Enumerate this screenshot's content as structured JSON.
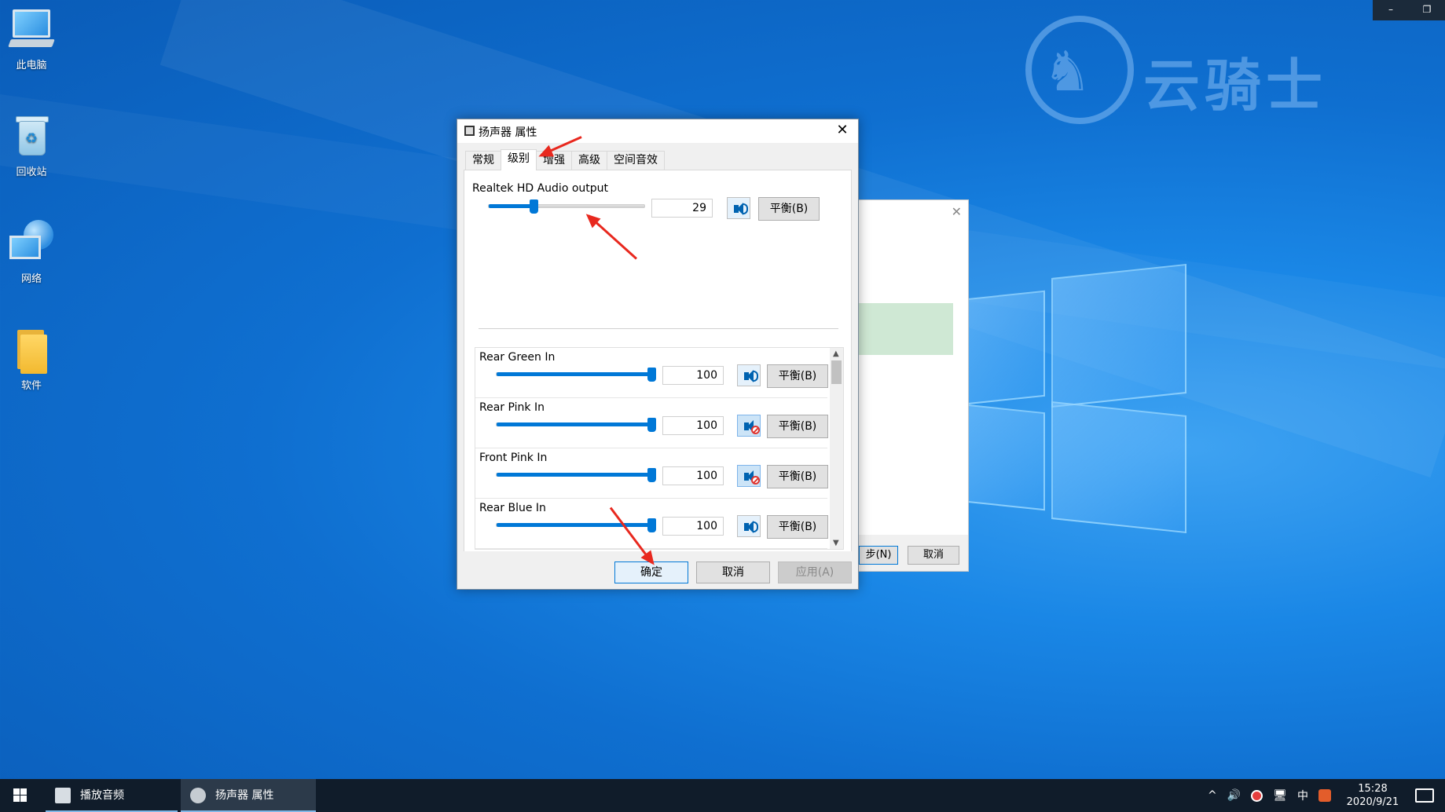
{
  "desktop": {
    "icons": [
      {
        "label": "此电脑"
      },
      {
        "label": "回收站"
      },
      {
        "label": "网络"
      },
      {
        "label": "软件"
      }
    ],
    "watermark": {
      "text": "云骑士"
    }
  },
  "top_controls": {
    "minimize": "–",
    "restore": "❐"
  },
  "background_dialog": {
    "close": "✕",
    "next_label": "步(N)",
    "cancel_label": "取消"
  },
  "dialog": {
    "title": "扬声器 属性",
    "close": "✕",
    "tabs": [
      {
        "label": "常规"
      },
      {
        "label": "级别"
      },
      {
        "label": "增强"
      },
      {
        "label": "高级"
      },
      {
        "label": "空间音效"
      }
    ],
    "active_tab": "级别",
    "main_device": {
      "label": "Realtek HD Audio output",
      "volume": "29",
      "muted": false,
      "balance_label": "平衡(B)"
    },
    "inputs": [
      {
        "label": "Rear Green In",
        "volume": "100",
        "muted": false,
        "balance_label": "平衡(B)"
      },
      {
        "label": "Rear Pink In",
        "volume": "100",
        "muted": true,
        "balance_label": "平衡(B)"
      },
      {
        "label": "Front Pink In",
        "volume": "100",
        "muted": true,
        "balance_label": "平衡(B)"
      },
      {
        "label": "Rear Blue In",
        "volume": "100",
        "muted": false,
        "balance_label": "平衡(B)"
      }
    ],
    "buttons": {
      "ok": "确定",
      "cancel": "取消",
      "apply": "应用(A)"
    }
  },
  "taskbar": {
    "items": [
      {
        "label": "播放音频"
      },
      {
        "label": "扬声器 属性"
      }
    ],
    "tray": {
      "chevron": "^",
      "volume": "🔊",
      "ime": "中",
      "time": "15:28",
      "date": "2020/9/21"
    }
  },
  "colors": {
    "accent": "#0078d7",
    "annotation_arrow": "#e8281e",
    "desktop_blue": "#1a87e6",
    "taskbar": "#101c2a"
  }
}
